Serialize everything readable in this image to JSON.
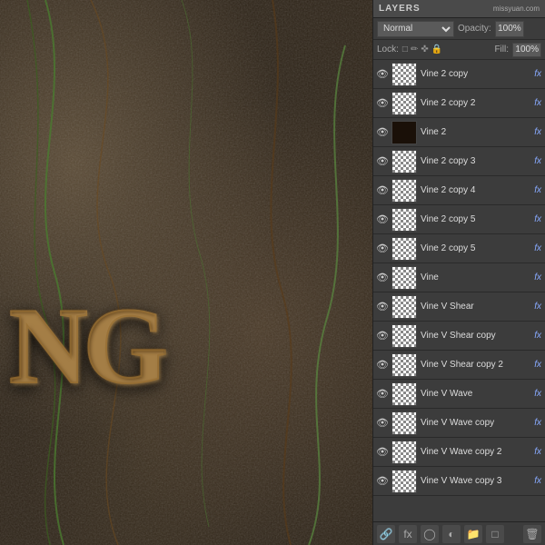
{
  "panel": {
    "title": "LAYERS",
    "watermark": "missyuan.com",
    "blend_mode": "Normal",
    "opacity_label": "Opacity:",
    "opacity_value": "100%",
    "lock_label": "Lock:",
    "fill_label": "Fill:",
    "fill_value": "100%"
  },
  "layers": [
    {
      "id": 1,
      "name": "Vine 2 copy",
      "visible": true,
      "fx": true,
      "thumb": "checker",
      "selected": false
    },
    {
      "id": 2,
      "name": "Vine 2 copy 2",
      "visible": true,
      "fx": true,
      "thumb": "checker",
      "selected": false
    },
    {
      "id": 3,
      "name": "Vine 2",
      "visible": true,
      "fx": true,
      "thumb": "dark",
      "selected": false
    },
    {
      "id": 4,
      "name": "Vine 2 copy 3",
      "visible": true,
      "fx": true,
      "thumb": "checker",
      "selected": false
    },
    {
      "id": 5,
      "name": "Vine 2 copy 4",
      "visible": true,
      "fx": true,
      "thumb": "checker",
      "selected": false
    },
    {
      "id": 6,
      "name": "Vine 2 copy 5",
      "visible": true,
      "fx": true,
      "thumb": "checker",
      "selected": false
    },
    {
      "id": 7,
      "name": "Vine 2 copy 5",
      "visible": true,
      "fx": true,
      "thumb": "checker",
      "selected": false
    },
    {
      "id": 8,
      "name": "Vine",
      "visible": true,
      "fx": true,
      "thumb": "checker",
      "selected": false
    },
    {
      "id": 9,
      "name": "Vine V Shear",
      "visible": true,
      "fx": true,
      "thumb": "checker",
      "selected": false
    },
    {
      "id": 10,
      "name": "Vine V Shear copy",
      "visible": true,
      "fx": true,
      "thumb": "checker",
      "selected": false
    },
    {
      "id": 11,
      "name": "Vine V Shear copy 2",
      "visible": true,
      "fx": true,
      "thumb": "checker",
      "selected": false
    },
    {
      "id": 12,
      "name": "Vine V Wave",
      "visible": true,
      "fx": true,
      "thumb": "checker",
      "selected": false
    },
    {
      "id": 13,
      "name": "Vine V Wave copy",
      "visible": true,
      "fx": true,
      "thumb": "checker",
      "selected": false
    },
    {
      "id": 14,
      "name": "Vine V Wave copy 2",
      "visible": true,
      "fx": true,
      "thumb": "checker",
      "selected": false
    },
    {
      "id": 15,
      "name": "Vine V Wave copy 3",
      "visible": true,
      "fx": true,
      "thumb": "checker",
      "selected": false
    }
  ],
  "bottom_buttons": [
    "link-icon",
    "fx-icon",
    "mask-icon",
    "adjustment-icon",
    "folder-icon",
    "delete-icon"
  ],
  "canvas": {
    "text": "NG"
  }
}
